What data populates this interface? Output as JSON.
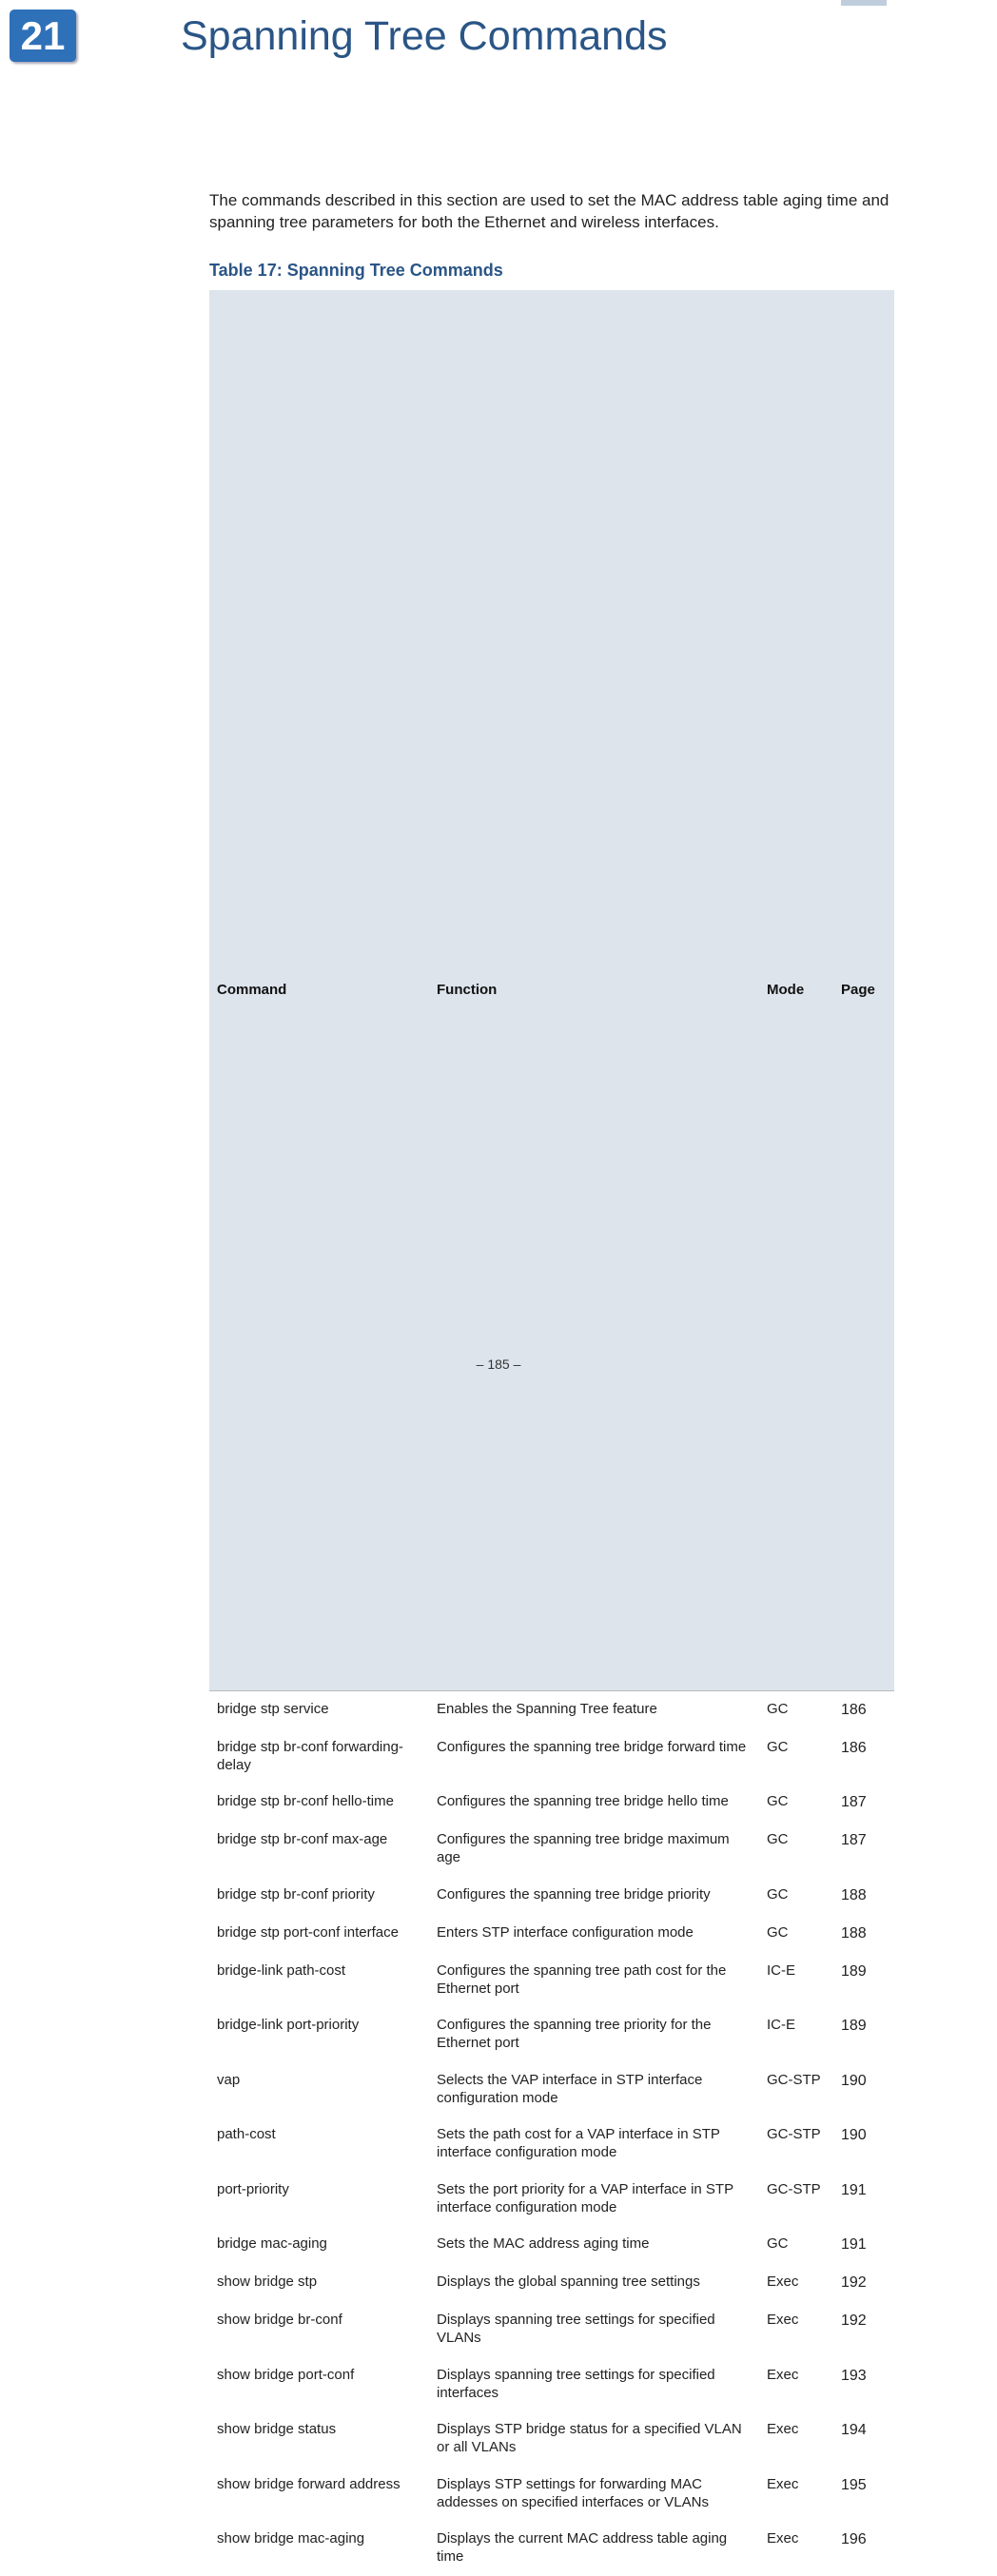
{
  "chapter": {
    "number": "21",
    "title": "Spanning Tree Commands"
  },
  "intro": "The commands described in this section are used to set the MAC address table aging time and spanning tree parameters for both the Ethernet and wireless interfaces.",
  "table": {
    "title": "Table 17: Spanning Tree Commands",
    "headers": {
      "command": "Command",
      "function": "Function",
      "mode": "Mode",
      "page": "Page"
    },
    "rows": [
      {
        "command": "bridge stp service",
        "function": "Enables the Spanning Tree feature",
        "mode": "GC",
        "page": "186"
      },
      {
        "command": "bridge stp br-conf forwarding-delay",
        "function": "Configures the spanning tree bridge forward time",
        "mode": "GC",
        "page": "186"
      },
      {
        "command": "bridge stp br-conf hello-time",
        "function": "Configures the spanning tree bridge hello time",
        "mode": "GC",
        "page": "187"
      },
      {
        "command": "bridge stp br-conf max-age",
        "function": "Configures the spanning tree bridge maximum age",
        "mode": "GC",
        "page": "187"
      },
      {
        "command": "bridge stp br-conf priority",
        "function": "Configures the spanning tree bridge priority",
        "mode": "GC",
        "page": "188"
      },
      {
        "command": "bridge stp port-conf interface",
        "function": "Enters STP interface configuration mode",
        "mode": "GC",
        "page": "188"
      },
      {
        "command": "bridge-link path-cost",
        "function": "Configures the spanning tree path cost for the Ethernet port",
        "mode": "IC-E",
        "page": "189"
      },
      {
        "command": "bridge-link port-priority",
        "function": "Configures the spanning tree priority for the Ethernet port",
        "mode": "IC-E",
        "page": "189"
      },
      {
        "command": "vap",
        "function": "Selects the VAP interface in STP interface configuration mode",
        "mode": "GC-STP",
        "page": "190"
      },
      {
        "command": "path-cost",
        "function": "Sets the path cost for a VAP interface in STP interface configuration mode",
        "mode": "GC-STP",
        "page": "190"
      },
      {
        "command": "port-priority",
        "function": "Sets the port priority for a VAP interface in STP interface configuration mode",
        "mode": "GC-STP",
        "page": "191"
      },
      {
        "command": "bridge mac-aging",
        "function": "Sets the MAC address aging time",
        "mode": "GC",
        "page": "191"
      },
      {
        "command": "show bridge stp",
        "function": "Displays the global spanning tree settings",
        "mode": "Exec",
        "page": "192"
      },
      {
        "command": "show bridge br-conf",
        "function": "Displays spanning tree settings for specified VLANs",
        "mode": "Exec",
        "page": "192"
      },
      {
        "command": "show bridge port-conf",
        "function": "Displays spanning tree settings for specified interfaces",
        "mode": "Exec",
        "page": "193"
      },
      {
        "command": "show bridge status",
        "function": "Displays STP bridge status for a specified VLAN or all VLANs",
        "mode": "Exec",
        "page": "194"
      },
      {
        "command": "show bridge forward address",
        "function": "Displays STP settings for forwarding MAC addesses on specified interfaces or VLANs",
        "mode": "Exec",
        "page": "195"
      },
      {
        "command": "show bridge mac-aging",
        "function": "Displays the current MAC address table aging time",
        "mode": "Exec",
        "page": "196"
      }
    ]
  },
  "footer": "–  185  –"
}
